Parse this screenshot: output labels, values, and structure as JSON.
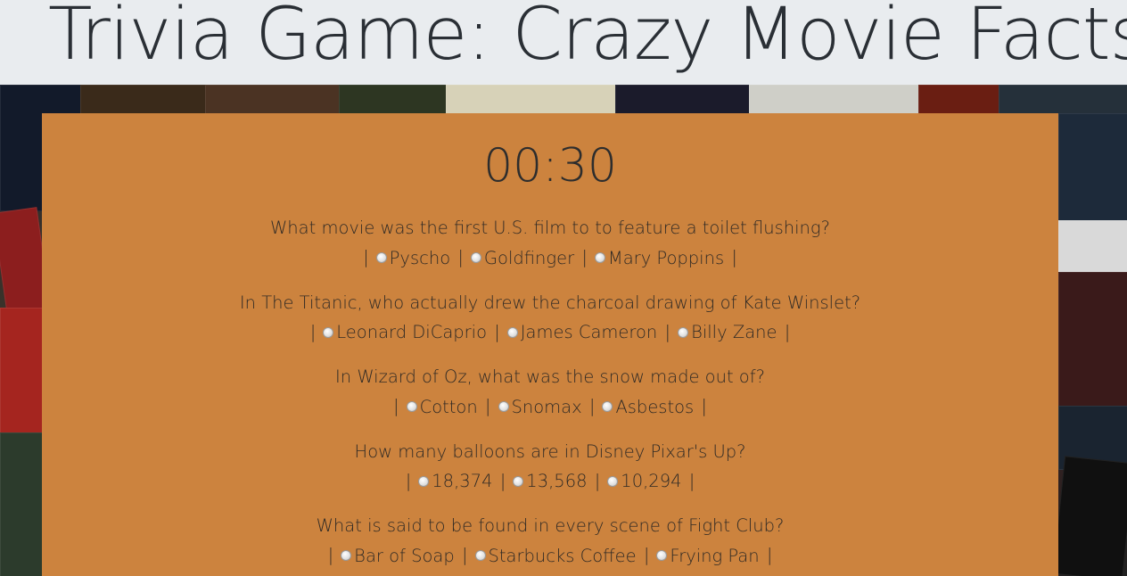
{
  "header": {
    "title": "Trivia Game: Crazy Movie Facts"
  },
  "game": {
    "timer": "00:30"
  },
  "questions": [
    {
      "text": "What movie was the first U.S. film to to feature a toilet flushing?",
      "options": [
        "Pyscho",
        "Goldfinger",
        "Mary Poppins"
      ]
    },
    {
      "text": "In The Titanic, who actually drew the charcoal drawing of Kate Winslet?",
      "options": [
        "Leonard DiCaprio",
        "James Cameron",
        "Billy Zane"
      ]
    },
    {
      "text": "In Wizard of Oz, what was the snow made out of?",
      "options": [
        "Cotton",
        "Snomax",
        "Asbestos"
      ]
    },
    {
      "text": "How many balloons are in Disney Pixar's Up?",
      "options": [
        "18,374",
        "13,568",
        "10,294"
      ]
    },
    {
      "text": "What is said to be found in every scene of Fight Club?",
      "options": [
        "Bar of Soap",
        "Starbucks Coffee",
        "Frying Pan"
      ]
    }
  ],
  "colors": {
    "header_bg": "#e9ecef",
    "panel_bg": "#cc833e",
    "text": "#2f2a25"
  }
}
